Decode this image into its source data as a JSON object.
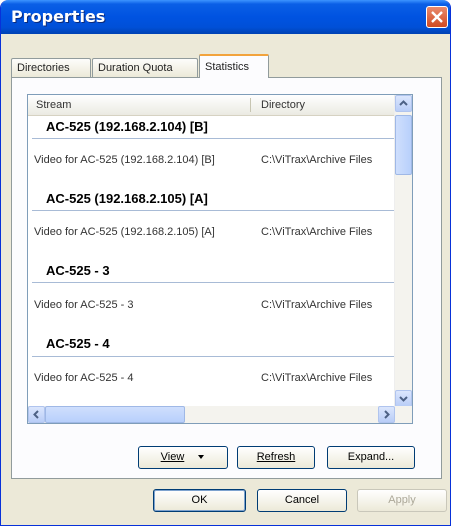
{
  "window": {
    "title": "Properties"
  },
  "tabs": [
    {
      "label": "Directories"
    },
    {
      "label": "Duration Quota"
    },
    {
      "label": "Statistics"
    }
  ],
  "list": {
    "columns": [
      "Stream",
      "Directory"
    ],
    "groups": [
      {
        "title": "AC-525 (192.168.2.104) [B]",
        "stream": "Video for AC-525 (192.168.2.104) [B]",
        "directory": "C:\\ViTrax\\Archive Files"
      },
      {
        "title": "AC-525 (192.168.2.105) [A]",
        "stream": "Video for AC-525 (192.168.2.105) [A]",
        "directory": "C:\\ViTrax\\Archive Files"
      },
      {
        "title": "AC-525 - 3",
        "stream": "Video for AC-525 - 3",
        "directory": "C:\\ViTrax\\Archive Files"
      },
      {
        "title": "AC-525 - 4",
        "stream": "Video for AC-525 - 4",
        "directory": "C:\\ViTrax\\Archive Files"
      }
    ]
  },
  "panel_buttons": {
    "view": "View",
    "refresh": "Refresh",
    "expand": "Expand..."
  },
  "dialog_buttons": {
    "ok": "OK",
    "cancel": "Cancel",
    "apply": "Apply"
  },
  "icons": {
    "close": "close-icon",
    "dropdown": "chevron-down-icon"
  }
}
